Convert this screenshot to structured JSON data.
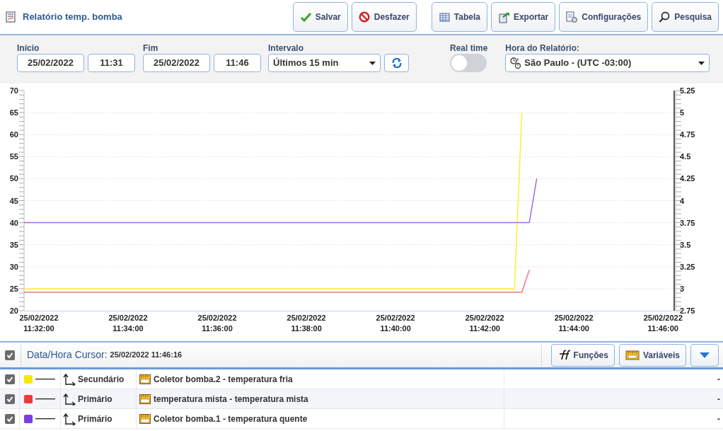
{
  "window": {
    "title": "Relatório temp. bomba"
  },
  "toolbar": [
    {
      "label": "Salvar",
      "kind": "save"
    },
    {
      "label": "Desfazer",
      "kind": "undo"
    },
    {
      "label": "Tabela",
      "kind": "table"
    },
    {
      "label": "Exportar",
      "kind": "export"
    },
    {
      "label": "Configurações",
      "kind": "settings"
    },
    {
      "label": "Pesquisa",
      "kind": "search"
    }
  ],
  "filters": {
    "start_label": "Início",
    "start_date": "25/02/2022",
    "start_time": "11:31",
    "end_label": "Fim",
    "end_date": "25/02/2022",
    "end_time": "11:46",
    "interval_label": "Intervalo",
    "interval": "Últimos 15 min",
    "realtime_label": "Real time",
    "realtime_on": false,
    "timezone_label": "Hora do Relatório:",
    "timezone": "São Paulo - (UTC -03:00)"
  },
  "chart": {
    "chart_data": {
      "type": "line",
      "grid": true,
      "categories": [
        null,
        null,
        "25/02/2022 11:32:00",
        null,
        null,
        null,
        null,
        null,
        null,
        null,
        null,
        null,
        null,
        null,
        "25/02/2022 11:34:00",
        null,
        null,
        null,
        null,
        null,
        null,
        null,
        null,
        null,
        null,
        null,
        "25/02/2022 11:36:00",
        null,
        null,
        null,
        null,
        null,
        null,
        null,
        null,
        null,
        null,
        null,
        "25/02/2022 11:38:00",
        null,
        null,
        null,
        null,
        null,
        null,
        null,
        null,
        null,
        null,
        null,
        "25/02/2022 11:40:00",
        null,
        null,
        null,
        null,
        null,
        null,
        null,
        null,
        null,
        null,
        null,
        "25/02/2022 11:42:00",
        null,
        null,
        null,
        null,
        null,
        null,
        null,
        null,
        null,
        null,
        null,
        "25/02/2022 11:44:00",
        null,
        null,
        null,
        null,
        null,
        null,
        null,
        null,
        null,
        null,
        null,
        "25/02/2022 11:46:00",
        null
      ],
      "ylim": [
        20,
        70
      ],
      "y2lim": [
        2.75,
        5.25
      ],
      "yticks": [
        20,
        25,
        30,
        35,
        40,
        45,
        50,
        55,
        60,
        65,
        70
      ],
      "y2ticks": [
        2.75,
        3,
        3.25,
        3.5,
        3.75,
        4,
        4.25,
        4.5,
        4.75,
        5,
        5.25
      ],
      "series": [
        {
          "name": "Coletor bomba.2 - temperatura fria",
          "color": "#ffee33",
          "axis": "y2",
          "values": [
            3,
            3,
            3,
            3,
            3,
            3,
            3,
            3,
            3,
            3,
            3,
            3,
            3,
            3,
            3,
            3,
            3,
            3,
            3,
            3,
            3,
            3,
            3,
            3,
            3,
            3,
            3,
            3,
            3,
            3,
            3,
            3,
            3,
            3,
            3,
            3,
            3,
            3,
            3,
            3,
            3,
            3,
            3,
            3,
            3,
            3,
            3,
            3,
            3,
            3,
            3,
            3,
            3,
            3,
            3,
            3,
            3,
            3,
            3,
            3,
            3,
            3,
            3,
            3,
            3,
            3,
            3,
            5,
            null,
            null,
            null,
            null,
            null,
            null,
            null,
            null,
            null,
            null,
            null,
            null,
            null,
            null,
            null,
            null,
            null,
            null,
            null,
            null
          ]
        },
        {
          "name": "temperatura mista - temperatura mista",
          "color": "#f07a7a",
          "values": [
            24.2,
            24.2,
            24.2,
            24.2,
            24.2,
            24.2,
            24.2,
            24.2,
            24.2,
            24.2,
            24.2,
            24.2,
            24.2,
            24.2,
            24.2,
            24.2,
            24.2,
            24.2,
            24.2,
            24.2,
            24.2,
            24.2,
            24.2,
            24.2,
            24.2,
            24.2,
            24.2,
            24.2,
            24.2,
            24.2,
            24.2,
            24.2,
            24.2,
            24.2,
            24.2,
            24.2,
            24.2,
            24.2,
            24.2,
            24.2,
            24.2,
            24.2,
            24.2,
            24.2,
            24.2,
            24.2,
            24.2,
            24.2,
            24.2,
            24.2,
            24.2,
            24.2,
            24.2,
            24.2,
            24.2,
            24.2,
            24.2,
            24.2,
            24.2,
            24.2,
            24.2,
            24.2,
            24.2,
            24.2,
            24.2,
            24.2,
            24.2,
            24.2,
            29.3,
            null,
            null,
            null,
            null,
            null,
            null,
            null,
            null,
            null,
            null,
            null,
            null,
            null,
            null,
            null,
            null,
            null,
            null,
            null
          ]
        },
        {
          "name": "Coletor bomba.1 - temperatura quente",
          "color": "#9a6ee0",
          "values": [
            40,
            40,
            40,
            40,
            40,
            40,
            40,
            40,
            40,
            40,
            40,
            40,
            40,
            40,
            40,
            40,
            40,
            40,
            40,
            40,
            40,
            40,
            40,
            40,
            40,
            40,
            40,
            40,
            40,
            40,
            40,
            40,
            40,
            40,
            40,
            40,
            40,
            40,
            40,
            40,
            40,
            40,
            40,
            40,
            40,
            40,
            40,
            40,
            40,
            40,
            40,
            40,
            40,
            40,
            40,
            40,
            40,
            40,
            40,
            40,
            40,
            40,
            40,
            40,
            40,
            40,
            40,
            40,
            40,
            50,
            null,
            null,
            null,
            null,
            null,
            null,
            null,
            null,
            null,
            null,
            null,
            null,
            null,
            null,
            null,
            null,
            null,
            null
          ]
        }
      ]
    }
  },
  "cursor_bar": {
    "all_checked": true,
    "label": "Data/Hora Cursor:",
    "value": "25/02/2022 11:46:16",
    "buttons": [
      {
        "label": "Funções",
        "kind": "functions"
      },
      {
        "label": "Variáveis",
        "kind": "variables"
      },
      {
        "kind": "dropdown"
      }
    ]
  },
  "legend": [
    {
      "checked": true,
      "color": "#f5ea00",
      "axis": "Secundário",
      "value": "-"
    },
    {
      "checked": true,
      "color": "#f03a3a",
      "axis": "Primário",
      "value": "-"
    },
    {
      "checked": true,
      "color": "#7b3fe0",
      "axis": "Primário",
      "value": "-"
    }
  ]
}
